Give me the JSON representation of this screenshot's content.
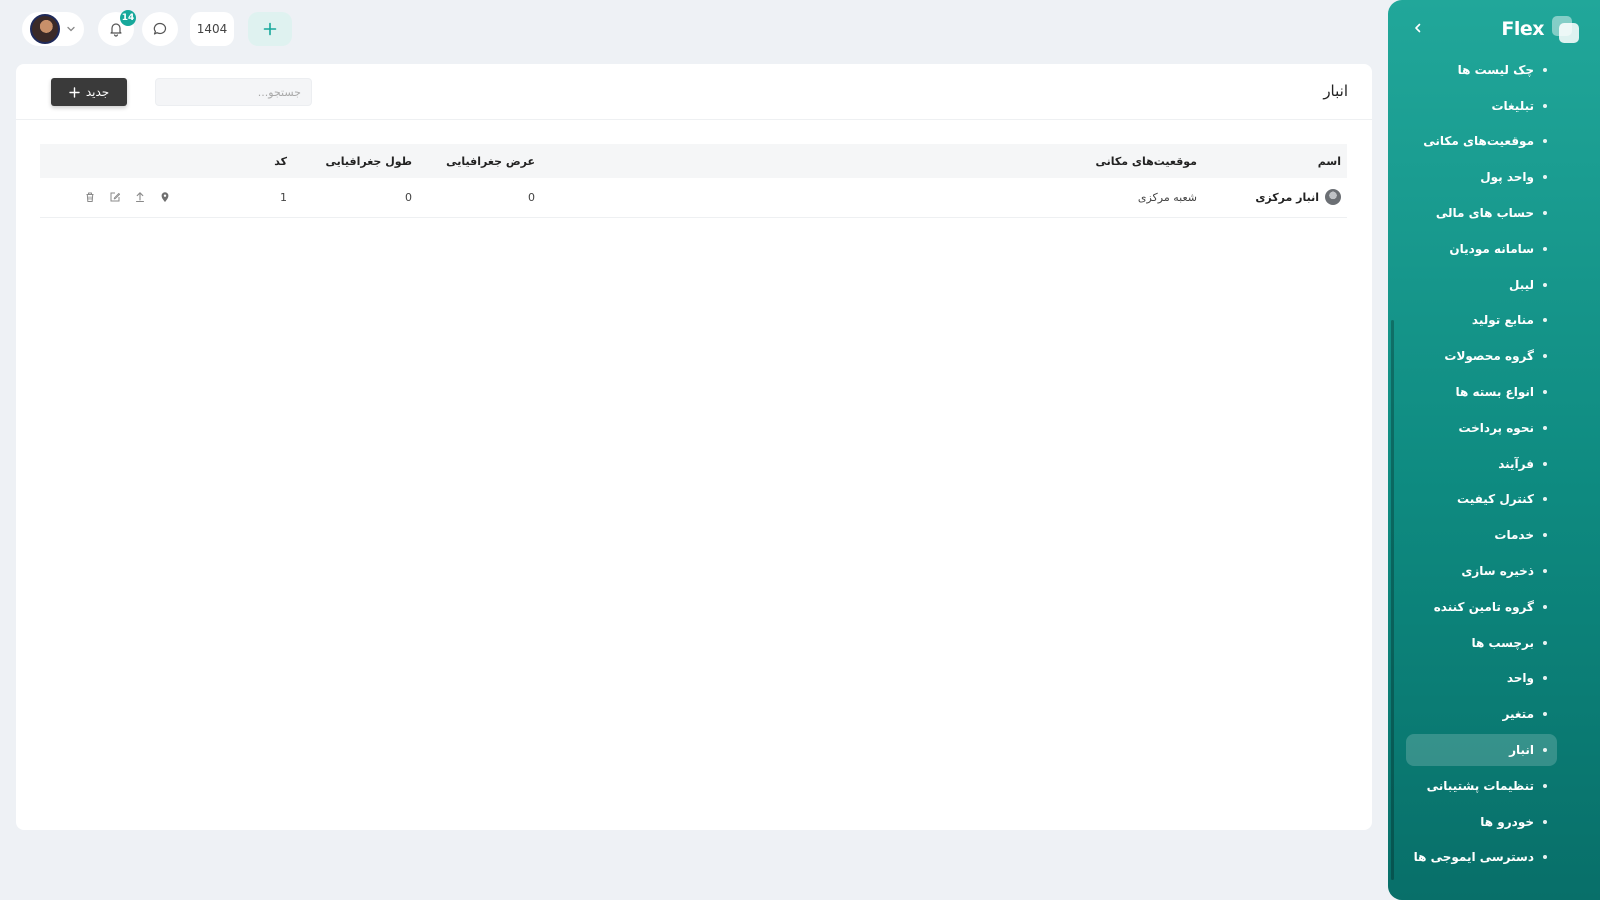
{
  "brand": {
    "name": "Flex"
  },
  "topbar": {
    "notification_count": "14",
    "year": "1404"
  },
  "sidebar": {
    "items": [
      {
        "label": "چک لیست ها"
      },
      {
        "label": "تبلیغات"
      },
      {
        "label": "موقعیت‌های مکانی"
      },
      {
        "label": "واحد پول"
      },
      {
        "label": "حساب های مالی"
      },
      {
        "label": "سامانه مودیان"
      },
      {
        "label": "لیبل"
      },
      {
        "label": "منابع تولید"
      },
      {
        "label": "گروه محصولات"
      },
      {
        "label": "انواع بسته ها"
      },
      {
        "label": "نحوه پرداخت"
      },
      {
        "label": "فرآیند"
      },
      {
        "label": "کنترل کیفیت"
      },
      {
        "label": "خدمات"
      },
      {
        "label": "ذخیره سازی"
      },
      {
        "label": "گروه تامین کننده"
      },
      {
        "label": "برچسب ها"
      },
      {
        "label": "واحد"
      },
      {
        "label": "متغیر"
      },
      {
        "label": "انبار",
        "active": true
      },
      {
        "label": "تنظیمات پشتیبانی"
      },
      {
        "label": "خودرو ها"
      },
      {
        "label": "دسترسی ایموجی ها"
      }
    ]
  },
  "main": {
    "title": "انبار",
    "search_placeholder": "جستجو...",
    "new_button": "جدید",
    "table": {
      "headers": {
        "name": "اسم",
        "locations": "موقعیت‌های مکانی",
        "latitude": "عرض جغرافیایی",
        "longitude": "طول جغرافیایی",
        "code": "کد"
      },
      "rows": [
        {
          "name": "انبار مرکزی",
          "locations": "شعبه مرکزی",
          "latitude": "0",
          "longitude": "0",
          "code": "1"
        }
      ]
    }
  },
  "colors": {
    "sidebar_gradient_top": "#21a79a",
    "sidebar_gradient_bottom": "#086f69",
    "accent": "#17a89b",
    "new_button_bg": "#3a3a3a"
  }
}
